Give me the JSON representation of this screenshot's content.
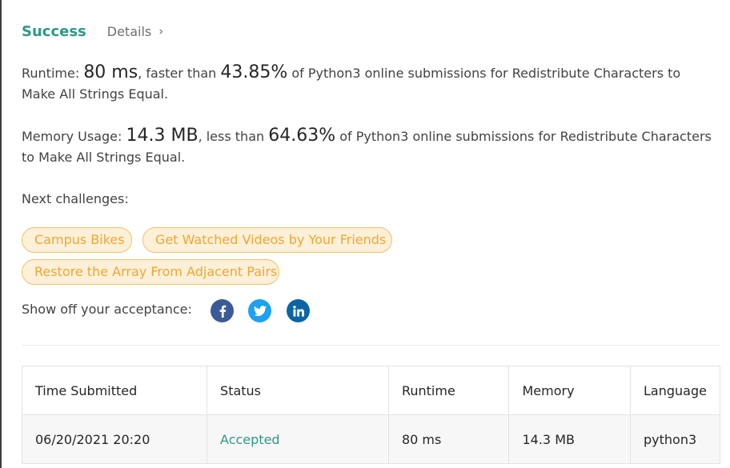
{
  "header": {
    "status": "Success",
    "details_label": "Details",
    "chevron": "›"
  },
  "runtime": {
    "label": "Runtime:",
    "value": "80 ms",
    "comparison": ", faster than",
    "percent": "43.85%",
    "suffix": "of Python3 online submissions for Redistribute Characters to Make All Strings Equal."
  },
  "memory": {
    "label": "Memory Usage:",
    "value": "14.3 MB",
    "comparison": ", less than",
    "percent": "64.63%",
    "suffix": "of Python3 online submissions for Redistribute Characters to Make All Strings Equal."
  },
  "next_challenges": {
    "label": "Next challenges:",
    "items": [
      "Campus Bikes",
      "Get Watched Videos by Your Friends",
      "Restore the Array From Adjacent Pairs"
    ]
  },
  "share": {
    "label": "Show off your acceptance:",
    "icons": [
      "facebook-icon",
      "twitter-icon",
      "linkedin-icon"
    ]
  },
  "submissions": {
    "columns": [
      "Time Submitted",
      "Status",
      "Runtime",
      "Memory",
      "Language"
    ],
    "rows": [
      [
        "06/20/2021 20:20",
        "Accepted",
        "80 ms",
        "14.3 MB",
        "python3"
      ]
    ]
  },
  "colors": {
    "success": "#2b9a86",
    "pill_text": "#f0a536",
    "pill_bg": "#fdf0d6",
    "facebook": "#3b5a98",
    "twitter": "#1da1f2",
    "linkedin": "#0a66a3"
  }
}
